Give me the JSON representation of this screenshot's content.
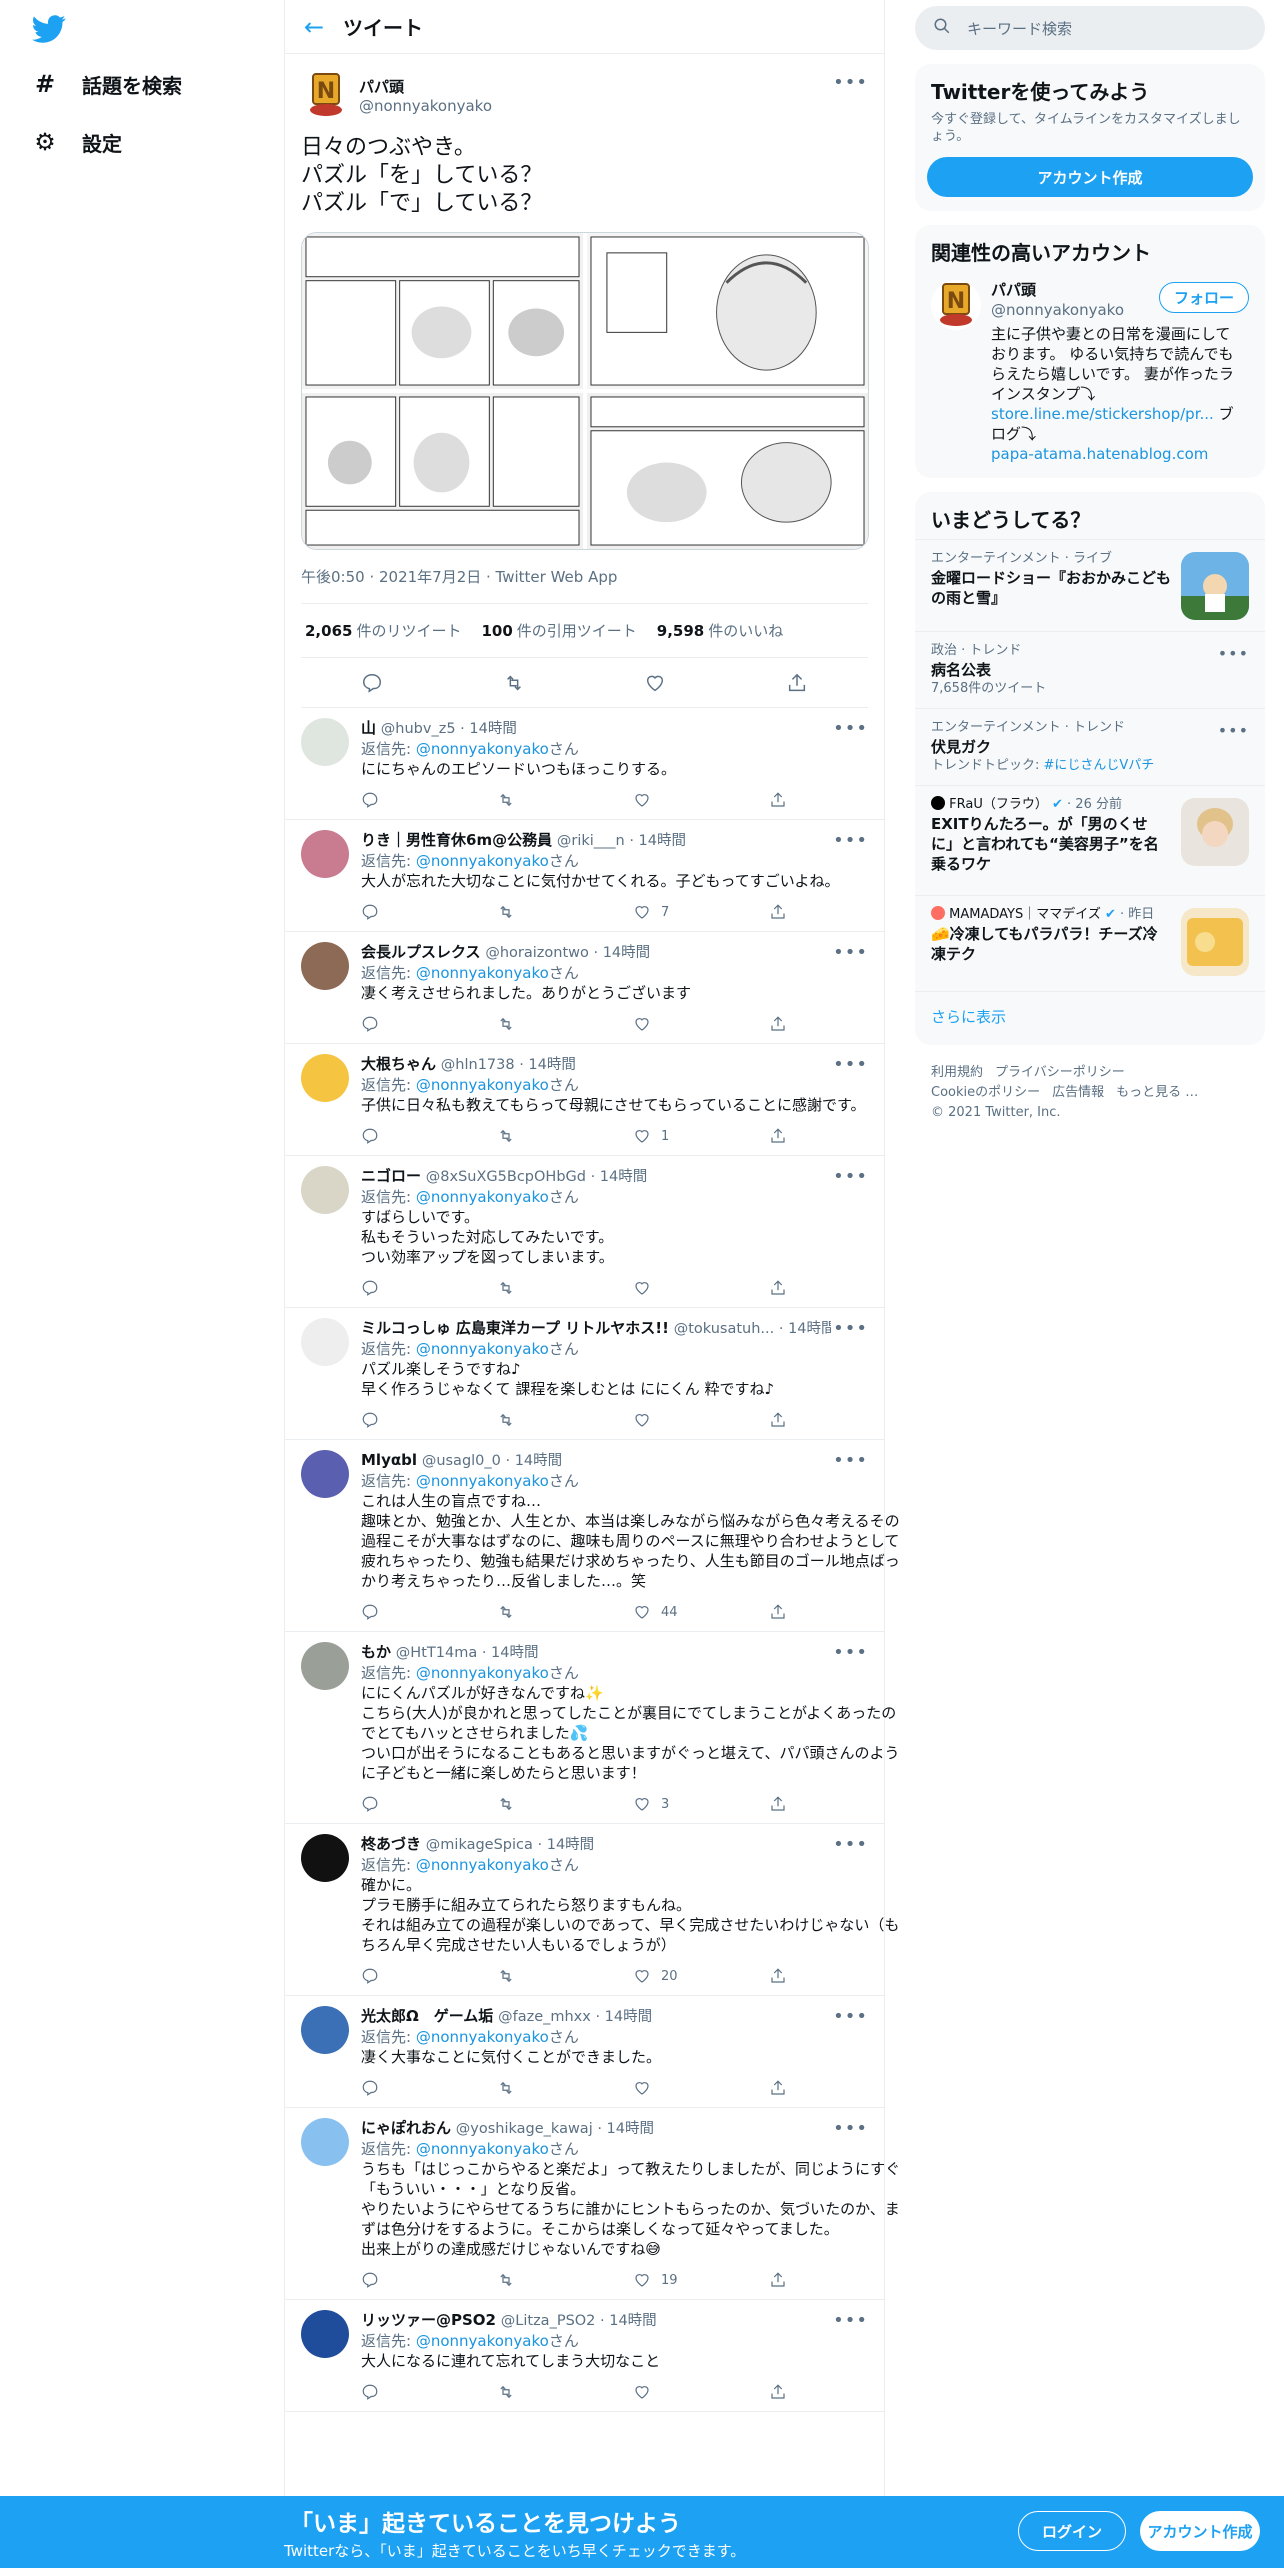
{
  "nav": {
    "explore_label": "話題を検索",
    "settings_label": "設定"
  },
  "main": {
    "header_title": "ツイート"
  },
  "tweet": {
    "author_name": "パパ頭",
    "author_handle": "@nonnyakonyako",
    "text": "日々のつぶやき。\nパズル「を」している？\nパズル「で」している？",
    "timestamp": "午後0:50 · 2021年7月2日 · Twitter Web App",
    "retweets_count": "2,065",
    "retweets_label": "件のリツイート",
    "quotes_count": "100",
    "quotes_label": "件の引用ツイート",
    "likes_count": "9,598",
    "likes_label": "件のいいね"
  },
  "replies": [
    {
      "name": "山",
      "meta": "@hubv_z5 · 14時間",
      "replyto_prefix": "返信先: ",
      "replyto_handle": "@nonnyakonyako",
      "replyto_suffix": "さん",
      "text": "ににちゃんのエピソードいつもほっこりする。",
      "likes": ""
    },
    {
      "name": "りき｜男性育休6m@公務員",
      "meta": "@riki___n · 14時間",
      "replyto_prefix": "返信先: ",
      "replyto_handle": "@nonnyakonyako",
      "replyto_suffix": "さん",
      "text": "大人が忘れた大切なことに気付かせてくれる。子どもってすごいよね。",
      "likes": "7"
    },
    {
      "name": "会長ルプスレクス",
      "meta": "@horaizontwo · 14時間",
      "replyto_prefix": "返信先: ",
      "replyto_handle": "@nonnyakonyako",
      "replyto_suffix": "さん",
      "text": "凄く考えさせられました。ありがとうございます",
      "likes": ""
    },
    {
      "name": "大根ちゃん",
      "meta": "@hln1738 · 14時間",
      "replyto_prefix": "返信先: ",
      "replyto_handle": "@nonnyakonyako",
      "replyto_suffix": "さん",
      "text": "子供に日々私も教えてもらって母親にさせてもらっていることに感謝です。",
      "likes": "1"
    },
    {
      "name": "ニゴロー",
      "meta": "@8xSuXG5BcpOHbGd · 14時間",
      "replyto_prefix": "返信先: ",
      "replyto_handle": "@nonnyakonyako",
      "replyto_suffix": "さん",
      "text": "すばらしいです。\n私もそういった対応してみたいです。\nつい効率アップを図ってしまいます。",
      "likes": ""
    },
    {
      "name": "ミルコっしゅ 広島東洋カープ リトルヤホス!!",
      "meta": "@tokusatuh... · 14時間",
      "replyto_prefix": "返信先: ",
      "replyto_handle": "@nonnyakonyako",
      "replyto_suffix": "さん",
      "text": "パズル楽しそうですね♪\n早く作ろうじゃなくて 課程を楽しむとは ににくん 粋ですね♪",
      "likes": ""
    },
    {
      "name": "Mlyαbl",
      "meta": "@usagl0_0 · 14時間",
      "replyto_prefix": "返信先: ",
      "replyto_handle": "@nonnyakonyako",
      "replyto_suffix": "さん",
      "text": "これは人生の盲点ですね…\n趣味とか、勉強とか、人生とか、本当は楽しみながら悩みながら色々考えるその過程こそが大事なはずなのに、趣味も周りのペースに無理やり合わせようとして疲れちゃったり、勉強も結果だけ求めちゃったり、人生も節目のゴール地点ばっかり考えちゃったり…反省しました…。笑",
      "likes": "44"
    },
    {
      "name": "もか",
      "meta": "@HtT14ma · 14時間",
      "replyto_prefix": "返信先: ",
      "replyto_handle": "@nonnyakonyako",
      "replyto_suffix": "さん",
      "text": "ににくんパズルが好きなんですね✨\nこちら(大人)が良かれと思ってしたことが裏目にでてしまうことがよくあったのでとてもハッとさせられました💦\nつい口が出そうになることもあると思いますがぐっと堪えて、パパ頭さんのように子どもと一緒に楽しめたらと思います！",
      "likes": "3"
    },
    {
      "name": "柊あづき",
      "meta": "@mikageSpica · 14時間",
      "replyto_prefix": "返信先: ",
      "replyto_handle": "@nonnyakonyako",
      "replyto_suffix": "さん",
      "text": "確かに。\nプラモ勝手に組み立てられたら怒りますもんね。\nそれは組み立ての過程が楽しいのであって、早く完成させたいわけじゃない（もちろん早く完成させたい人もいるでしょうが）",
      "likes": "20"
    },
    {
      "name": "光太郎Ω　ゲーム垢",
      "meta": "@faze_mhxx · 14時間",
      "replyto_prefix": "返信先: ",
      "replyto_handle": "@nonnyakonyako",
      "replyto_suffix": "さん",
      "text": "凄く大事なことに気付くことができました。",
      "likes": ""
    },
    {
      "name": "にゃぽれおん",
      "meta": "@yoshikage_kawaj · 14時間",
      "replyto_prefix": "返信先: ",
      "replyto_handle": "@nonnyakonyako",
      "replyto_suffix": "さん",
      "text": "うちも「はじっこからやると楽だよ」って教えたりしましたが、同じようにすぐ「もういい・・・」となり反省。\nやりたいようにやらせてるうちに誰かにヒントもらったのか、気づいたのか、まずは色分けをするように。そこからは楽しくなって延々やってました。\n出来上がりの達成感だけじゃないんですね😅",
      "likes": "19"
    },
    {
      "name": "リッツァー@PSO2",
      "meta": "@Litza_PSO2 · 14時間",
      "replyto_prefix": "返信先: ",
      "replyto_handle": "@nonnyakonyako",
      "replyto_suffix": "さん",
      "text": "大人になるに連れて忘れてしまう大切なこと",
      "likes": ""
    }
  ],
  "right": {
    "search_placeholder": "キーワード検索",
    "signup_title": "Twitterを使ってみよう",
    "signup_sub": "今すぐ登録して、タイムラインをカスタマイズしましょう。",
    "signup_button": "アカウント作成",
    "related_title": "関連性の高いアカウント",
    "related_name": "パパ頭",
    "related_handle": "@nonnyakonyako",
    "follow_button": "フォロー",
    "related_bio": "主に子供や妻との日常を漫画にしております。 ゆるい気持ちで読んでもらえたら嬉しいです。 妻が作ったラインスタンプ⤵︎",
    "related_link1": "store.line.me/stickershop/pr...",
    "related_blog": " ブログ⤵︎",
    "related_link2": "papa-atama.hatenablog.com",
    "trends_title": "いまどうしてる？",
    "trends": [
      {
        "cat": "エンターテインメント · ライブ",
        "title": "金曜ロードショー『おおかみこどもの雨と雪』",
        "sub": ""
      },
      {
        "cat": "政治 · トレンド",
        "title": "病名公表",
        "sub": "7,658件のツイート"
      },
      {
        "cat": "エンターテインメント · トレンド",
        "title": "伏見ガク",
        "sub_prefix": "トレンドトピック: ",
        "sub_link": "#にじさんじVパチ"
      },
      {
        "source": "FRaU（フラウ）",
        "time": "· 26 分前",
        "title": "EXITりんたろー。が「男のくせに」と言われても“美容男子”を名乗るワケ"
      },
      {
        "source": "MAMADAYS｜ママデイズ",
        "time": "· 昨日",
        "title": "🧀冷凍してもパラパラ！チーズ冷凍テク"
      }
    ],
    "show_more": "さらに表示",
    "footer_links": [
      "利用規約",
      "プライバシーポリシー",
      "Cookieのポリシー",
      "広告情報",
      "もっと見る …"
    ],
    "copyright": "© 2021 Twitter, Inc."
  },
  "bottom_bar": {
    "title": "「いま」起きていることを見つけよう",
    "sub": "Twitterなら、「いま」起きていることをいち早くチェックできます。",
    "login": "ログイン",
    "signup": "アカウント作成"
  },
  "colors": {
    "accent": "#1da1f2",
    "link": "#1b95e0",
    "muted": "#5b7083",
    "divider": "#ebeef0"
  }
}
